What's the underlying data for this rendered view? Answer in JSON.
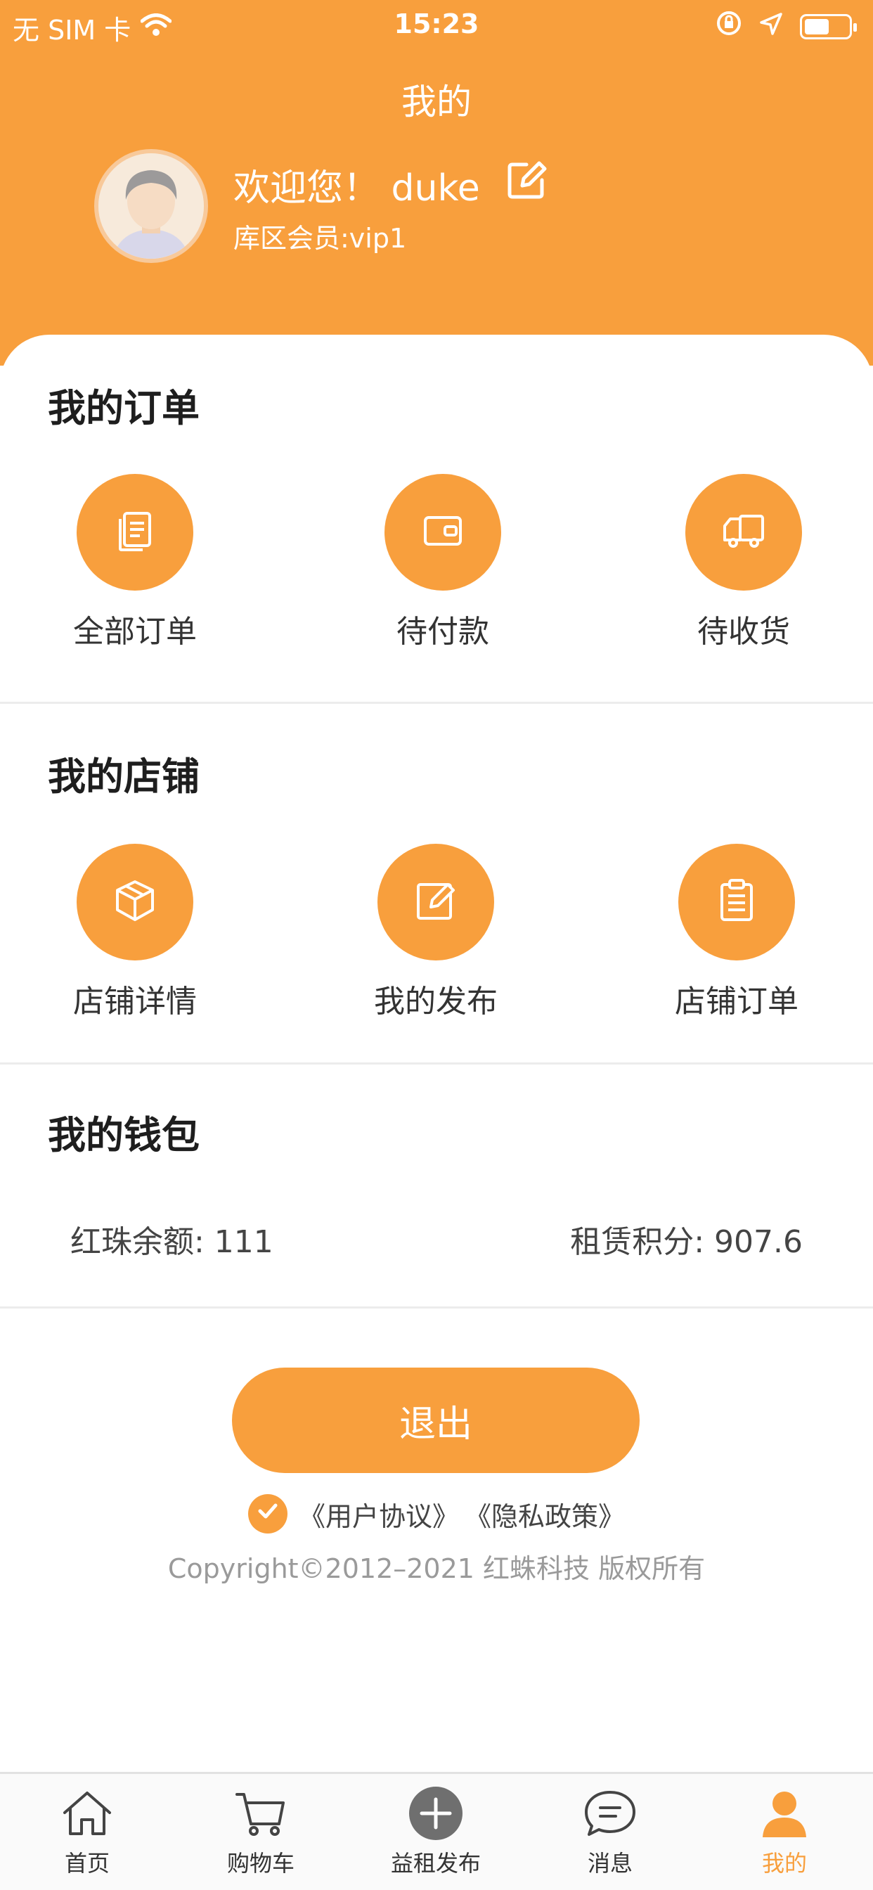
{
  "status_bar": {
    "carrier": "无 SIM 卡",
    "time": "15:23",
    "battery_level": 0.55
  },
  "header": {
    "title": "我的",
    "welcome": "欢迎您！  duke",
    "member_level": "库区会员:vip1"
  },
  "orders": {
    "title": "我的订单",
    "items": [
      {
        "label": "全部订单",
        "icon": "document-icon"
      },
      {
        "label": "待付款",
        "icon": "wallet-icon"
      },
      {
        "label": "待收货",
        "icon": "truck-icon"
      }
    ]
  },
  "store": {
    "title": "我的店铺",
    "items": [
      {
        "label": "店铺详情",
        "icon": "cube-icon"
      },
      {
        "label": "我的发布",
        "icon": "edit-icon"
      },
      {
        "label": "店铺订单",
        "icon": "clipboard-icon"
      }
    ]
  },
  "wallet": {
    "title": "我的钱包",
    "balance": "红珠余额: 111",
    "points": "租赁积分: 907.6"
  },
  "logout_label": "退出",
  "agreement": {
    "user_agreement": "《用户协议》",
    "privacy_policy": "《隐私政策》",
    "checked": true
  },
  "copyright": "Copyright©2012–2021 红蛛科技 版权所有",
  "tabbar": {
    "items": [
      {
        "label": "首页",
        "icon": "home-icon"
      },
      {
        "label": "购物车",
        "icon": "cart-icon"
      },
      {
        "label": "益租发布",
        "icon": "plus-circle-icon"
      },
      {
        "label": "消息",
        "icon": "message-icon"
      },
      {
        "label": "我的",
        "icon": "user-icon"
      }
    ],
    "active": "我的"
  },
  "colors": {
    "accent": "#f89f3d",
    "background": "#ffffff",
    "divider": "#ececec"
  }
}
